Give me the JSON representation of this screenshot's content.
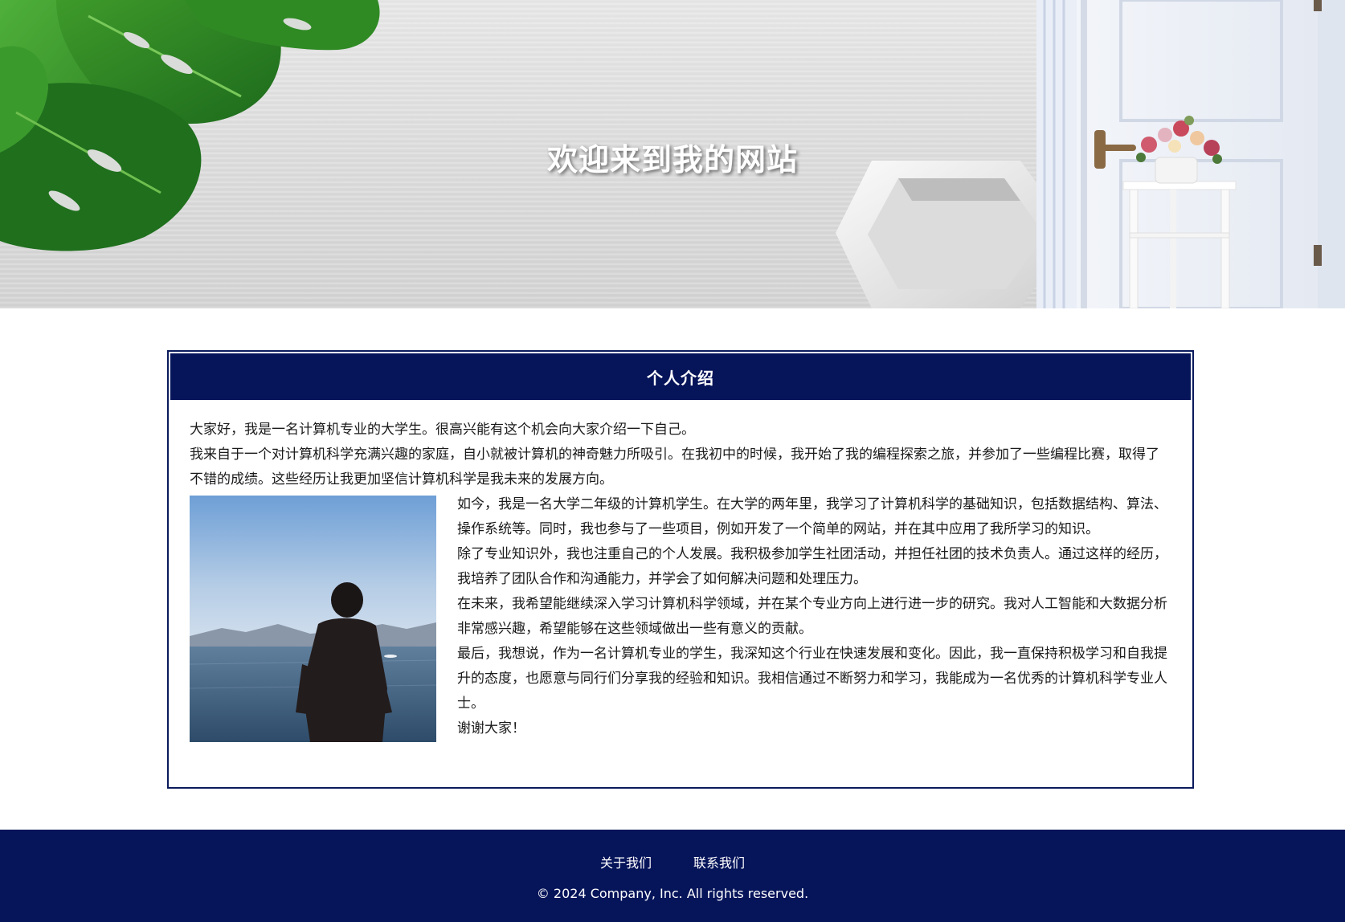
{
  "hero": {
    "title": "欢迎来到我的网站"
  },
  "intro": {
    "heading": "个人介绍",
    "paragraphs_top": [
      "大家好，我是一名计算机专业的大学生。很高兴能有这个机会向大家介绍一下自己。",
      "我来自于一个对计算机科学充满兴趣的家庭，自小就被计算机的神奇魅力所吸引。在我初中的时候，我开始了我的编程探索之旅，并参加了一些编程比赛，取得了不错的成绩。这些经历让我更加坚信计算机科学是我未来的发展方向。"
    ],
    "paragraphs_side": [
      "如今，我是一名大学二年级的计算机学生。在大学的两年里，我学习了计算机科学的基础知识，包括数据结构、算法、操作系统等。同时，我也参与了一些项目，例如开发了一个简单的网站，并在其中应用了我所学习的知识。",
      "除了专业知识外，我也注重自己的个人发展。我积极参加学生社团活动，并担任社团的技术负责人。通过这样的经历，我培养了团队合作和沟通能力，并学会了如何解决问题和处理压力。",
      "在未来，我希望能继续深入学习计算机科学领域，并在某个专业方向上进行进一步的研究。我对人工智能和大数据分析非常感兴趣，希望能够在这些领域做出一些有意义的贡献。",
      "最后，我想说，作为一名计算机专业的学生，我深知这个行业在快速发展和变化。因此，我一直保持积极学习和自我提升的态度，也愿意与同行们分享我的经验和知识。我相信通过不断努力和学习，我能成为一名优秀的计算机科学专业人士。",
      "谢谢大家！"
    ]
  },
  "footer": {
    "links": [
      "关于我们",
      "联系我们"
    ],
    "copyright": "© 2024 Company, Inc. All rights reserved."
  },
  "colors": {
    "navy": "#06145a",
    "text": "#1a1a1a"
  }
}
